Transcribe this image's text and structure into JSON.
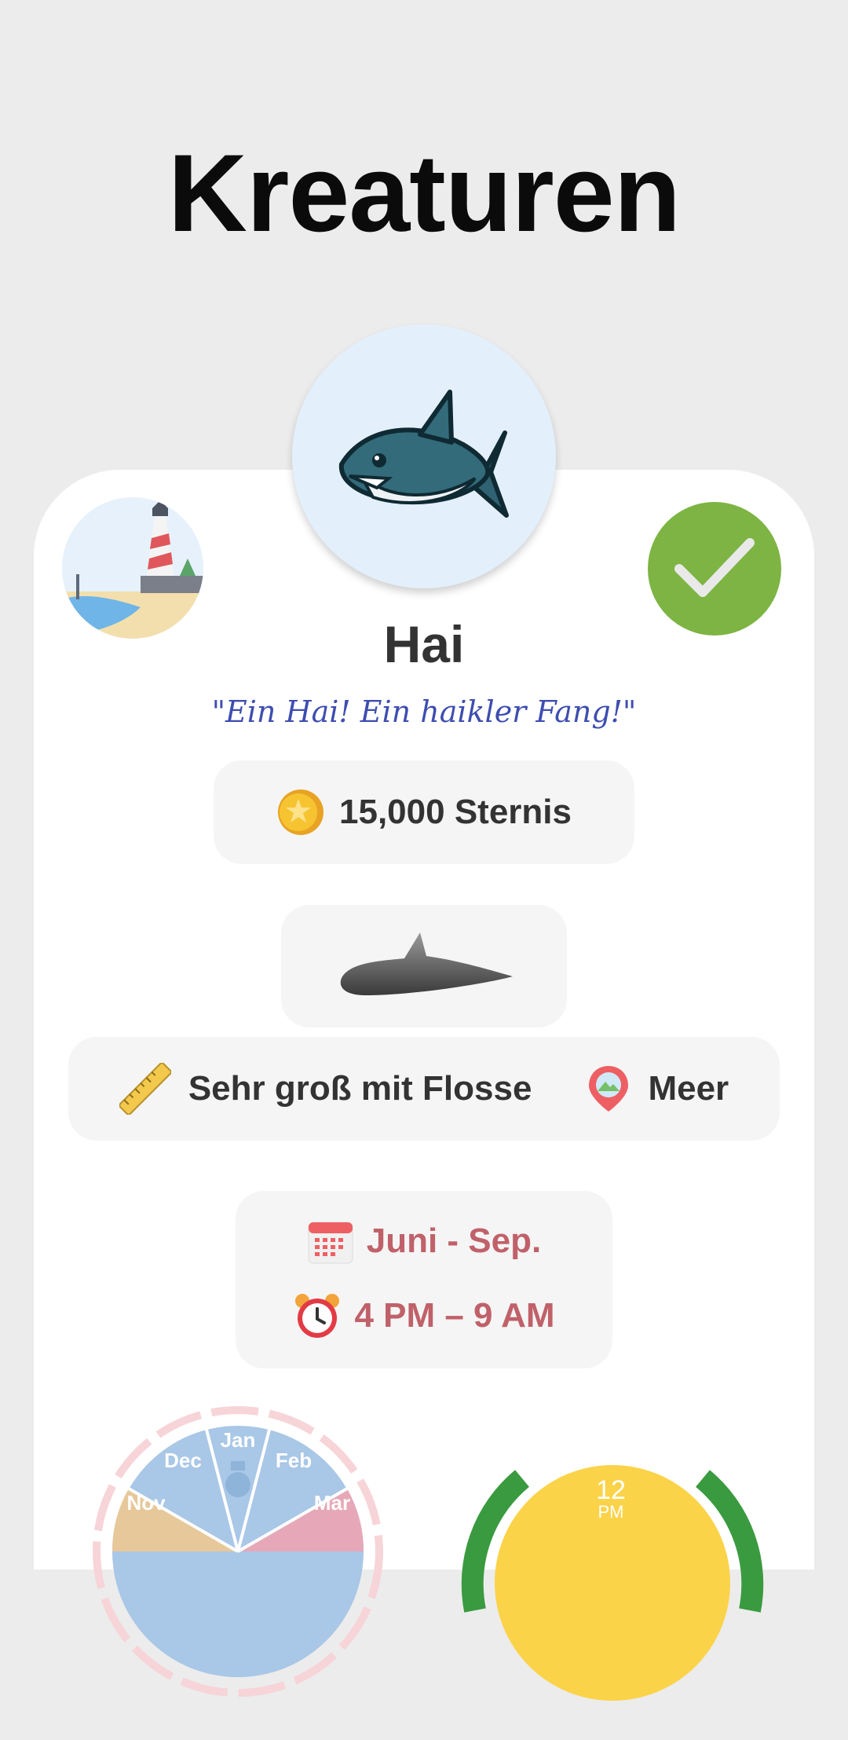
{
  "header": {
    "title": "Kreaturen"
  },
  "creature": {
    "name": "Hai",
    "quote": "\"Ein Hai! Ein haikler Fang!\"",
    "price": "15,000 Sternis",
    "size": "Sehr groß mit Flosse",
    "location": "Meer",
    "months": "Juni - Sep.",
    "time": "4 PM – 9 AM",
    "caught": true
  },
  "icons": {
    "hero": "shark-icon",
    "location_badge": "lighthouse-beach-icon",
    "caught_badge": "checkmark-icon",
    "price": "star-coin-icon",
    "shadow": "fish-shadow-icon",
    "size": "ruler-icon",
    "location": "map-pin-icon",
    "months": "calendar-icon",
    "time": "alarm-clock-icon"
  },
  "season_wheel": {
    "months": [
      "Jan",
      "Feb",
      "Mar",
      "Dec",
      "Nov"
    ]
  },
  "clock_wheel": {
    "hour": "12",
    "period": "PM"
  },
  "colors": {
    "accent_green": "#7db443",
    "quote_blue": "#3d4db0",
    "season_red": "#c0616a",
    "clock_yellow": "#fbd349",
    "clock_green": "#3a9a3f"
  }
}
